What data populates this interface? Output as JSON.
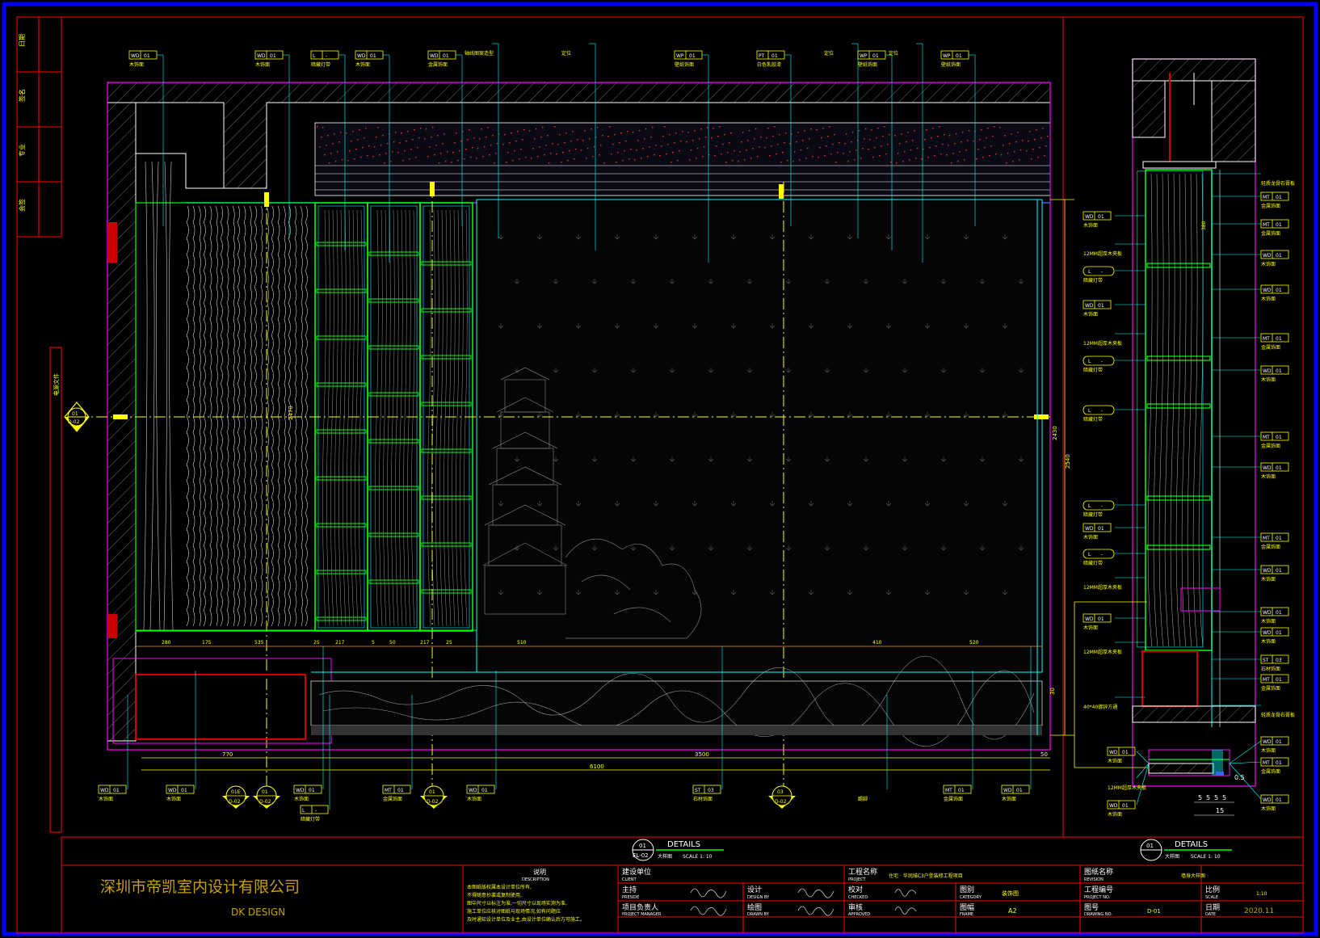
{
  "colors": {
    "frame": "#0000ff",
    "border": "#ff0000",
    "title": "#ffff00",
    "leader": "#00ffff",
    "wood": "#ffffff",
    "shelf": "#00ff00",
    "outline": "#ff00ff",
    "dim": "#ffa500",
    "company": "#c8a000"
  },
  "left_strip": [
    "日期",
    "签名",
    "专业",
    "会签"
  ],
  "side_note": "电源文件",
  "section_marker": {
    "num": "01",
    "ref": "D-02"
  },
  "top_tags": [
    {
      "code": "WD",
      "num": "01",
      "label": "木饰面"
    },
    {
      "code": "WD",
      "num": "01",
      "label": "木饰面"
    },
    {
      "code": "L",
      "num": "-",
      "label": "暗藏灯带"
    },
    {
      "code": "WD",
      "num": "01",
      "label": "木饰面"
    },
    {
      "code": "WD",
      "num": "01",
      "label": "金属饰面"
    },
    {
      "code": "",
      "num": "",
      "label": "轴线图案造型"
    },
    {
      "code": "",
      "num": "",
      "label": "定位"
    },
    {
      "code": "WP",
      "num": "01",
      "label": "壁纸饰面"
    },
    {
      "code": "PT",
      "num": "01",
      "label": "白色乳胶漆"
    },
    {
      "code": "",
      "num": "",
      "label": "定位"
    },
    {
      "code": "WP",
      "num": "01",
      "label": "壁纸饰面"
    },
    {
      "code": "",
      "num": "",
      "label": "定位"
    },
    {
      "code": "WP",
      "num": "01",
      "label": "壁纸饰面"
    }
  ],
  "bottom_tags": [
    {
      "code": "WD",
      "num": "01",
      "label": "木饰面"
    },
    {
      "code": "WD",
      "num": "01",
      "label": "木饰面"
    },
    {
      "code": "WD",
      "num": "01",
      "label": "木饰面"
    },
    {
      "code": "MT",
      "num": "01",
      "label": "金属饰面"
    },
    {
      "code": "WD",
      "num": "01",
      "label": "木饰面"
    },
    {
      "code": "ST",
      "num": "03",
      "label": "石材饰面"
    },
    {
      "code": "",
      "num": "",
      "label": "踢脚"
    },
    {
      "code": "MT",
      "num": "01",
      "label": "金属饰面"
    },
    {
      "code": "WD",
      "num": "01",
      "label": "木饰面"
    },
    {
      "code": "L",
      "num": "-",
      "label": "暗藏灯带"
    }
  ],
  "bottom_markers": [
    {
      "num": "01E",
      "ref": "D-02"
    },
    {
      "num": "01",
      "ref": "D-02"
    },
    {
      "num": "01",
      "ref": "D-02"
    },
    {
      "num": "03",
      "ref": "D-02"
    }
  ],
  "dims_bottom": [
    "770",
    "3500",
    "6100",
    "50"
  ],
  "dims_row": [
    "280",
    "175",
    "535",
    "25",
    "217",
    "5",
    "50",
    "217",
    "25",
    "510",
    "410",
    "520"
  ],
  "dims_vert": [
    "2470",
    "2430",
    "2540",
    "30"
  ],
  "right_left_tags": [
    {
      "code": "WD",
      "num": "01",
      "label": "木饰面"
    },
    {
      "code": "",
      "num": "",
      "label": "12MM超厚木夹板"
    },
    {
      "code": "L",
      "num": "-",
      "label": "暗藏灯带"
    },
    {
      "code": "WD",
      "num": "01",
      "label": "木饰面"
    },
    {
      "code": "",
      "num": "",
      "label": "12MM超厚木夹板"
    },
    {
      "code": "L",
      "num": "-",
      "label": "暗藏灯带"
    },
    {
      "code": "L",
      "num": "-",
      "label": "暗藏灯带"
    },
    {
      "code": "L",
      "num": "-",
      "label": "暗藏灯带"
    },
    {
      "code": "WD",
      "num": "01",
      "label": "木饰面"
    },
    {
      "code": "L",
      "num": "-",
      "label": "暗藏灯带"
    },
    {
      "code": "",
      "num": "",
      "label": "12MM超厚木夹板"
    },
    {
      "code": "WD",
      "num": "01",
      "label": "木饰面"
    },
    {
      "code": "",
      "num": "",
      "label": "12MM超厚木夹板"
    },
    {
      "code": "",
      "num": "",
      "label": "40*40镀锌方通"
    }
  ],
  "right_right_tags": [
    {
      "code": "",
      "num": "",
      "label": "轻质龙骨石膏板"
    },
    {
      "code": "MT",
      "num": "01",
      "label": "金属饰面"
    },
    {
      "code": "MT",
      "num": "01",
      "label": "金属饰面"
    },
    {
      "code": "WD",
      "num": "01",
      "label": "木饰面"
    },
    {
      "code": "WD",
      "num": "01",
      "label": "木饰面"
    },
    {
      "code": "MT",
      "num": "01",
      "label": "金属饰面"
    },
    {
      "code": "WD",
      "num": "01",
      "label": "木饰面"
    },
    {
      "code": "MT",
      "num": "01",
      "label": "金属饰面"
    },
    {
      "code": "WD",
      "num": "01",
      "label": "木饰面"
    },
    {
      "code": "MT",
      "num": "01",
      "label": "金属饰面"
    },
    {
      "code": "WD",
      "num": "01",
      "label": "木饰面"
    },
    {
      "code": "WD",
      "num": "01",
      "label": "木饰面"
    },
    {
      "code": "WD",
      "num": "01",
      "label": "木饰面"
    },
    {
      "code": "ST",
      "num": "03",
      "label": "石材饰面"
    },
    {
      "code": "MT",
      "num": "01",
      "label": "金属饰面"
    },
    {
      "code": "",
      "num": "",
      "label": "轻质龙骨石膏板"
    }
  ],
  "detail_tags_left": [
    {
      "code": "WD",
      "num": "01",
      "label": "木饰面"
    },
    {
      "code": "",
      "num": "",
      "label": "12MM超厚木夹板"
    },
    {
      "code": "WD",
      "num": "01",
      "label": "木饰面"
    }
  ],
  "detail_tags_right": [
    {
      "code": "WD",
      "num": "01",
      "label": "木饰面"
    },
    {
      "code": "MT",
      "num": "01",
      "label": "金属饰面"
    },
    {
      "code": "WD",
      "num": "01",
      "label": "木饰面"
    }
  ],
  "detail_dims": [
    "5",
    "5",
    "5",
    "5",
    "15",
    "0.5"
  ],
  "detail_main": {
    "num": "01",
    "sheet": "EL-02",
    "heading": "DETAILS",
    "sub": "大样图",
    "scale": "SCALE 1: 10"
  },
  "detail_side": {
    "num": "01",
    "heading": "DETAILS",
    "sub": "大样图",
    "scale": "SCALE 1: 10"
  },
  "title_block": {
    "company_cn": "深圳市帝凯室内设计有限公司",
    "company_en": "DK  DESIGN",
    "notes_title": "说明",
    "notes_title_en": "DESCRIPTION",
    "notes": [
      "本图纸版权属本设计单位所有,",
      "不得随意抄袭或复制使用,",
      "图中尺寸以标注为准,一切尺寸以现场实测为准,",
      "施工单位应核对图纸与现场情况,如有问题应",
      "及时通知设计单位及业主,由设计单位确认后方可施工。"
    ],
    "client_label": "建设单位",
    "client_label_en": "CLIENT",
    "project_label": "工程名称",
    "project_label_en": "PROJECT",
    "project_name": "住宅 · 华润城C3户型装修工程项目",
    "sheet_label": "图纸名称",
    "sheet_label_en": "REVISION",
    "sheet_name": "墙身大样图",
    "rows": {
      "zc": "主持",
      "zc_en": "PRESIDE",
      "xm": "项目负责人",
      "xm_en": "PROJECT MANAGER",
      "sj": "设计",
      "sj_en": "DESIGN BY",
      "hz": "绘图",
      "hz_en": "DRAWN BY",
      "jd": "校对",
      "jd_en": "CHECKED",
      "sh": "审核",
      "sh_en": "APPROVED",
      "tb": "图别",
      "tb_en": "CATEGORY",
      "tb_val": "装饰图",
      "tf": "图幅",
      "tf_en": "FRAME",
      "tf_val": "A2",
      "gc": "工程编号",
      "gc_en": "PROJECT NO.",
      "th": "图号",
      "th_en": "DRAWING NO.",
      "th_val": "D-01",
      "bl": "比例",
      "bl_en": "SCALE",
      "bl_val": "1:10",
      "rq": "日期",
      "rq_en": "DATE",
      "rq_val": "2020.11"
    }
  }
}
